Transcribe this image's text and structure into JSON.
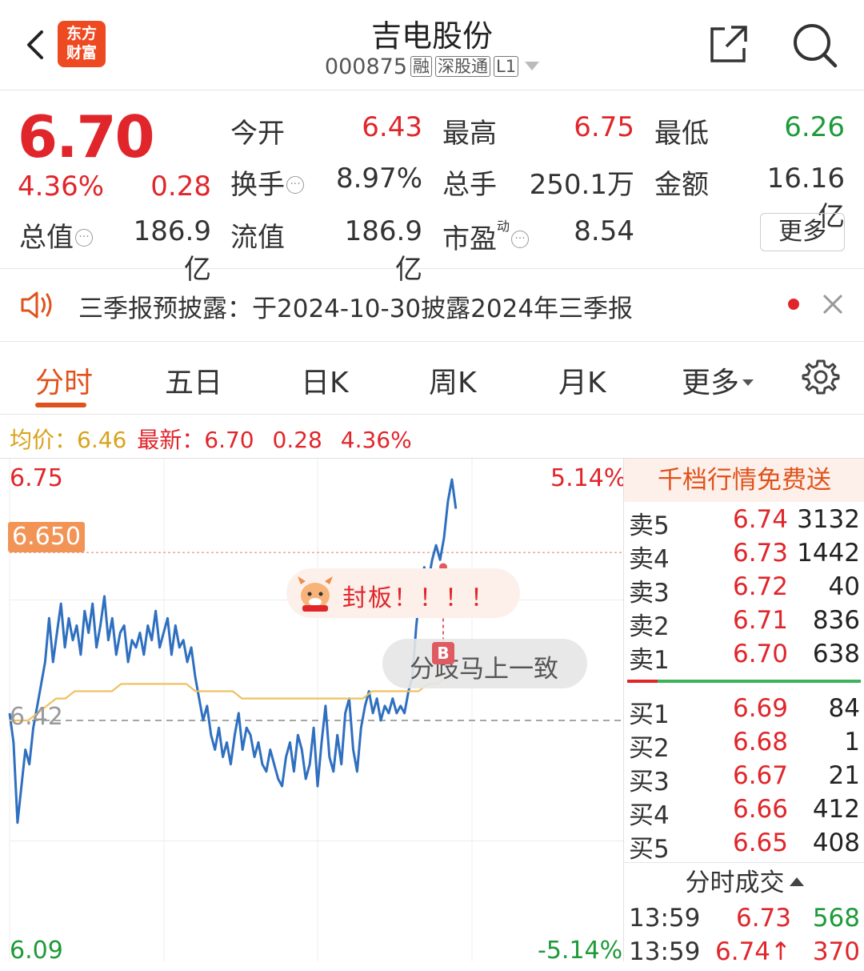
{
  "header": {
    "logo": [
      "东方",
      "财富"
    ],
    "stock_name": "吉电股份",
    "stock_code": "000875",
    "tags": [
      "融",
      "深股通",
      "L1"
    ]
  },
  "quote": {
    "price": "6.70",
    "change_pct": "4.36%",
    "change": "0.28",
    "rows": [
      [
        {
          "label": "今开",
          "value": "6.43",
          "color": "red"
        },
        {
          "label": "最高",
          "value": "6.75",
          "color": "red"
        },
        {
          "label": "最低",
          "value": "6.26",
          "color": "green"
        }
      ],
      [
        {
          "label": "换手",
          "value": "8.97%",
          "color": "gray"
        },
        {
          "label": "总手",
          "value": "250.1万",
          "color": "gray"
        },
        {
          "label": "金额",
          "value": "16.16亿",
          "color": "gray"
        }
      ],
      [
        {
          "label": "总值",
          "value": "186.9亿",
          "color": "gray"
        },
        {
          "label": "流值",
          "value": "186.9亿",
          "color": "gray"
        },
        {
          "label": "市盈",
          "value": "8.54",
          "color": "gray",
          "superscript": "动"
        }
      ]
    ],
    "more_label": "更多"
  },
  "notice": {
    "text": "三季报预披露：于2024-10-30披露2024年三季报"
  },
  "tabs": [
    "分时",
    "五日",
    "日K",
    "周K",
    "月K",
    "更多"
  ],
  "infoline": {
    "avg_label": "均价：",
    "avg_value": "6.46",
    "latest_label": "最新：",
    "latest_value": "6.70",
    "change": "0.28",
    "change_pct": "4.36%"
  },
  "chart": {
    "top_price": "6.75",
    "top_pct": "5.14%",
    "base_price": "6.42",
    "bottom_price": "6.09",
    "bottom_pct": "-5.14%",
    "current_tag": "6.650",
    "bubble_text": "封板！！！！",
    "toast_text": "分歧马上一致",
    "marker": "B"
  },
  "chart_data": {
    "type": "line",
    "ylim": [
      6.09,
      6.75
    ],
    "reference_price": 6.42,
    "series": [
      {
        "name": "",
        "values": [
          6.43,
          6.39,
          6.28,
          6.33,
          6.38,
          6.36,
          6.41,
          6.44,
          6.47,
          6.5,
          6.56,
          6.5,
          6.54,
          6.58,
          6.52,
          6.56,
          6.53,
          6.55,
          6.51,
          6.57,
          6.54,
          6.58,
          6.52,
          6.55,
          6.59,
          6.53,
          6.56,
          6.51,
          6.54,
          6.55,
          6.5,
          6.53,
          6.52,
          6.54,
          6.51,
          6.55,
          6.53,
          6.57,
          6.52,
          6.54,
          6.56,
          6.51,
          6.55,
          6.52,
          6.53,
          6.5,
          6.52,
          6.48,
          6.45,
          6.42,
          6.44,
          6.4,
          6.38,
          6.41,
          6.37,
          6.39,
          6.36,
          6.4,
          6.43,
          6.38,
          6.41,
          6.4,
          6.37,
          6.39,
          6.36,
          6.35,
          6.38,
          6.36,
          6.34,
          6.33,
          6.37,
          6.39,
          6.35,
          6.4,
          6.38,
          6.34,
          6.36,
          6.41,
          6.33,
          6.39,
          6.44,
          6.37,
          6.35,
          6.4,
          6.36,
          6.43,
          6.45,
          6.38,
          6.35,
          6.41,
          6.44,
          6.46,
          6.43,
          6.45,
          6.42,
          6.44,
          6.43,
          6.45,
          6.43,
          6.44,
          6.43,
          6.46,
          6.48,
          6.55,
          6.6,
          6.63,
          6.61,
          6.64,
          6.66,
          6.64,
          6.67,
          6.72,
          6.75,
          6.71
        ]
      },
      {
        "name": "",
        "values": [
          6.42,
          6.42,
          6.42,
          6.43,
          6.44,
          6.45,
          6.45,
          6.46,
          6.46,
          6.46,
          6.46,
          6.46,
          6.47,
          6.47,
          6.47,
          6.47,
          6.47,
          6.47,
          6.47,
          6.47,
          6.46,
          6.46,
          6.46,
          6.46,
          6.46,
          6.45,
          6.45,
          6.45,
          6.45,
          6.45,
          6.45,
          6.45,
          6.45,
          6.45,
          6.45,
          6.45,
          6.45,
          6.45,
          6.45,
          6.46,
          6.46,
          6.46,
          6.46,
          6.46,
          6.46,
          6.47,
          6.47,
          6.48,
          6.49
        ]
      }
    ]
  },
  "order_book": {
    "header": "千档行情免费送",
    "asks": [
      {
        "label": "卖5",
        "price": "6.74",
        "qty": "3132"
      },
      {
        "label": "卖4",
        "price": "6.73",
        "qty": "1442"
      },
      {
        "label": "卖3",
        "price": "6.72",
        "qty": "40"
      },
      {
        "label": "卖2",
        "price": "6.71",
        "qty": "836"
      },
      {
        "label": "卖1",
        "price": "6.70",
        "qty": "638"
      }
    ],
    "bids": [
      {
        "label": "买1",
        "price": "6.69",
        "qty": "84"
      },
      {
        "label": "买2",
        "price": "6.68",
        "qty": "1"
      },
      {
        "label": "买3",
        "price": "6.67",
        "qty": "21"
      },
      {
        "label": "买4",
        "price": "6.66",
        "qty": "412"
      },
      {
        "label": "买5",
        "price": "6.65",
        "qty": "408"
      }
    ],
    "ticks_header": "分时成交",
    "ticks": [
      {
        "time": "13:59",
        "price": "6.73",
        "vol": "568",
        "vol_color": "#1e9a3a"
      },
      {
        "time": "13:59",
        "price": "6.74↑",
        "vol": "370",
        "vol_color": "#e0262b"
      }
    ]
  }
}
